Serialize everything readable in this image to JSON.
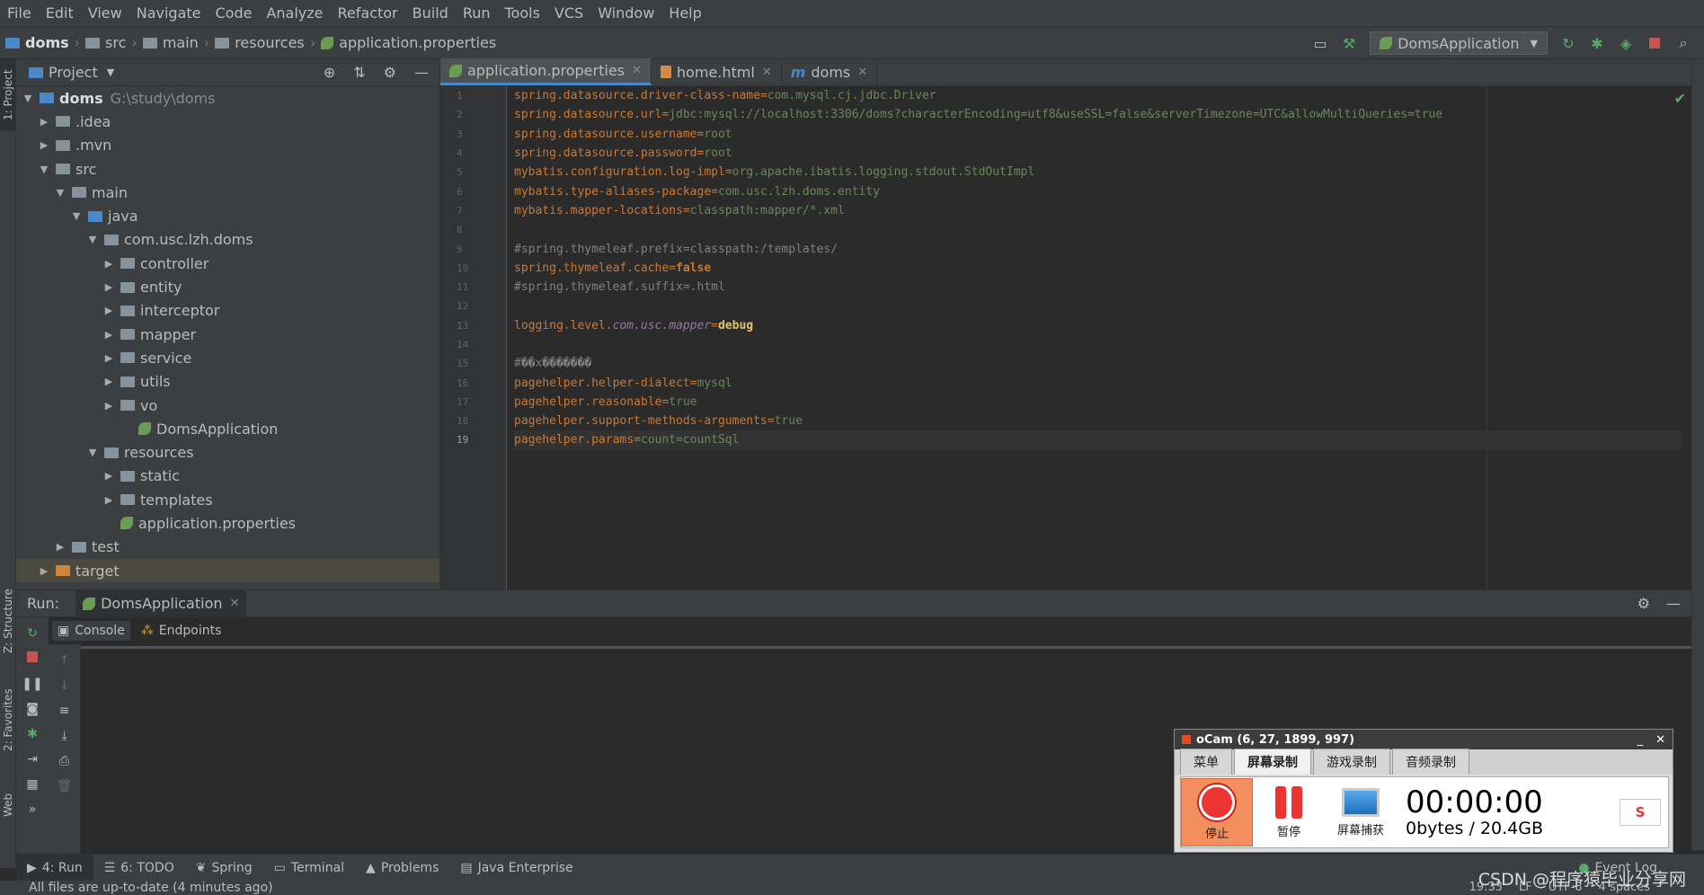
{
  "menu": [
    "File",
    "Edit",
    "View",
    "Navigate",
    "Code",
    "Analyze",
    "Refactor",
    "Build",
    "Run",
    "Tools",
    "VCS",
    "Window",
    "Help"
  ],
  "breadcrumb": [
    "doms",
    "src",
    "main",
    "resources",
    "application.properties"
  ],
  "run_config": "DomsApplication",
  "project": {
    "header": "Project",
    "root_label": "doms",
    "root_path": "G:\\study\\doms",
    "items": [
      ".idea",
      ".mvn",
      "src",
      "main",
      "java",
      "com.usc.lzh.doms",
      "controller",
      "entity",
      "interceptor",
      "mapper",
      "service",
      "utils",
      "vo",
      "DomsApplication",
      "resources",
      "static",
      "templates",
      "application.properties",
      "test",
      "target"
    ]
  },
  "tabs": [
    {
      "label": "application.properties"
    },
    {
      "label": "home.html"
    },
    {
      "label": "doms"
    }
  ],
  "editor": {
    "line_numbers": [
      "1",
      "2",
      "3",
      "4",
      "5",
      "6",
      "7",
      "8",
      "9",
      "10",
      "11",
      "12",
      "13",
      "14",
      "15",
      "16",
      "17",
      "18",
      "19"
    ],
    "lines": [
      {
        "key": "spring.datasource.driver-class-name",
        "eq": "=",
        "val": "com.mysql.cj.jdbc.Driver"
      },
      {
        "key": "spring.datasource.url",
        "eq": "=",
        "val": "jdbc:mysql://localhost:3306/doms?characterEncoding=utf8&useSSL=false&serverTimezone=UTC&allowMultiQueries=true"
      },
      {
        "key": "spring.datasource.username",
        "eq": "=",
        "val": "root"
      },
      {
        "key": "spring.datasource.password",
        "eq": "=",
        "val": "root"
      },
      {
        "key": "mybatis.configuration.log-impl",
        "eq": "=",
        "val": "org.apache.ibatis.logging.stdout.StdOutImpl"
      },
      {
        "key": "mybatis.type-aliases-package",
        "eq": "=",
        "val": "com.usc.lzh.doms.entity"
      },
      {
        "key": "mybatis.mapper-locations",
        "eq": "=",
        "val": "classpath:mapper/*.xml"
      },
      {
        "comment": ""
      },
      {
        "comment": "#spring.thymeleaf.prefix=classpath:/templates/"
      },
      {
        "key": "spring.thymeleaf.cache",
        "eq": "=",
        "val": "false"
      },
      {
        "comment": "#spring.thymeleaf.suffix=.html"
      },
      {
        "comment": ""
      },
      {
        "key": "logging.level.",
        "key_it": "com.usc.mapper",
        "eq": "=",
        "val": "debug"
      },
      {
        "comment": ""
      },
      {
        "comment": "#��x�������"
      },
      {
        "key": "pagehelper.helper-dialect",
        "eq": "=",
        "val": "mysql"
      },
      {
        "key": "pagehelper.reasonable",
        "eq": "=",
        "val": "true"
      },
      {
        "key": "pagehelper.support-methods-arguments",
        "eq": "=",
        "val": "true"
      },
      {
        "key": "pagehelper.params",
        "eq": "=",
        "val": "count=countSql"
      }
    ]
  },
  "run": {
    "label": "Run:",
    "config_tab": "DomsApplication",
    "console_tab": "Console",
    "endpoints_tab": "Endpoints"
  },
  "bottom_tabs": [
    "4: Run",
    "6: TODO",
    "Spring",
    "Terminal",
    "Problems",
    "Java Enterprise"
  ],
  "status": {
    "message": "All files are up-to-date (4 minutes ago)",
    "right": [
      "19:33",
      "LF",
      "UTF-8",
      "4 spaces"
    ]
  },
  "side_tabs": [
    "1: Project",
    "Z: Structure",
    "2: Favorites",
    "Web"
  ],
  "ocam": {
    "title": "oCam (6, 27, 1899, 997)",
    "tabs": [
      "菜单",
      "屏幕录制",
      "游戏录制",
      "音频录制"
    ],
    "stop": "停止",
    "pause": "暂停",
    "capture": "屏幕捕获",
    "timer": "00:00:00",
    "size": "0bytes / 20.4GB"
  },
  "event_log": "Event Log",
  "watermark": "CSDN @程序猿毕业分享网"
}
